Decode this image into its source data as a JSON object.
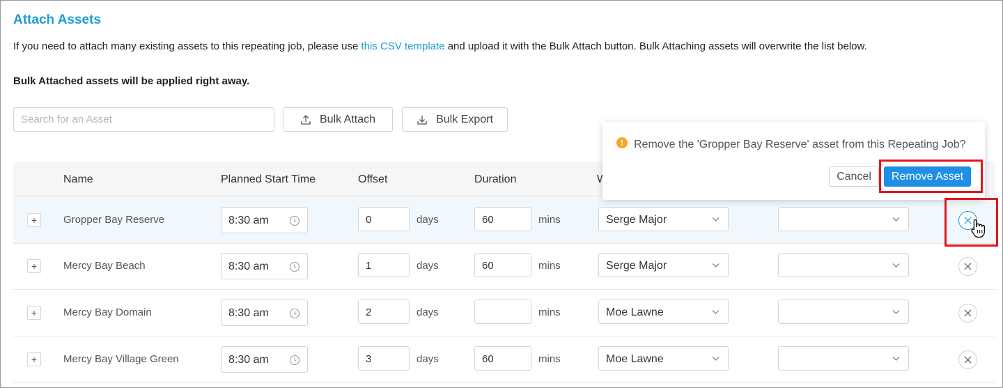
{
  "header": {
    "title": "Attach Assets",
    "description_before": "If you need to attach many existing assets to this repeating job, please use ",
    "description_link": "this CSV template",
    "description_after": " and upload it with the Bulk Attach button. Bulk Attaching assets will overwrite the list below.",
    "bold_note": "Bulk Attached assets will be applied right away."
  },
  "toolbar": {
    "search_placeholder": "Search for an Asset",
    "bulk_attach_label": "Bulk Attach",
    "bulk_export_label": "Bulk Export"
  },
  "table": {
    "columns": {
      "name": "Name",
      "planned_start": "Planned Start Time",
      "offset": "Offset",
      "duration": "Duration",
      "worker": "W"
    },
    "unit_days": "days",
    "unit_mins": "mins",
    "rows": [
      {
        "expander": "+",
        "name": "Gropper Bay Reserve",
        "start": "8:30 am",
        "offset": "0",
        "duration": "60",
        "worker": "Serge Major",
        "other": ""
      },
      {
        "expander": "+",
        "name": "Mercy Bay Beach",
        "start": "8:30 am",
        "offset": "1",
        "duration": "60",
        "worker": "Serge Major",
        "other": ""
      },
      {
        "expander": "+",
        "name": "Mercy Bay Domain",
        "start": "8:30 am",
        "offset": "2",
        "duration": "",
        "worker": "Moe Lawne",
        "other": ""
      },
      {
        "expander": "+",
        "name": "Mercy Bay Village Green",
        "start": "8:30 am",
        "offset": "3",
        "duration": "60",
        "worker": "Moe Lawne",
        "other": ""
      }
    ]
  },
  "popover": {
    "warning_icon": "!",
    "message": "Remove the 'Gropper Bay Reserve' asset from this Repeating Job?",
    "cancel_label": "Cancel",
    "confirm_label": "Remove Asset"
  },
  "colors": {
    "accent": "#1f9bd7",
    "primary_button": "#1f8fe6",
    "highlight": "#e2151b",
    "warning": "#f5a623"
  }
}
